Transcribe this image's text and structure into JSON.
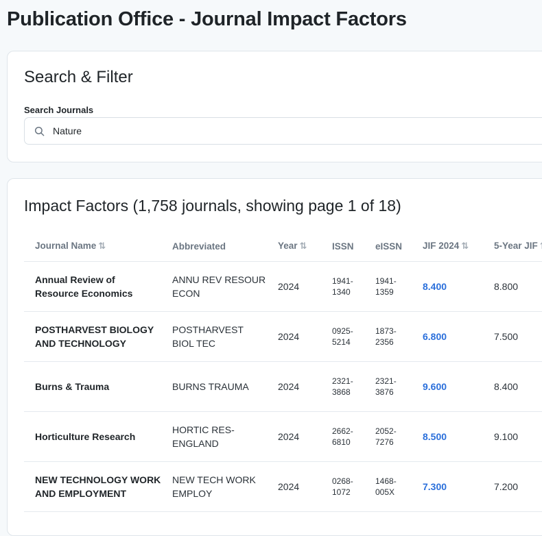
{
  "page": {
    "title": "Publication Office - Journal Impact Factors"
  },
  "search": {
    "heading": "Search & Filter",
    "label": "Search Journals",
    "value": "Nature",
    "icon": "search-icon"
  },
  "table": {
    "heading": "Impact Factors (1,758 journals, showing page 1 of 18)",
    "accent_color": "#2a6fdb",
    "columns": [
      {
        "label": "Journal Name",
        "sortable": true
      },
      {
        "label": "Abbreviated",
        "sortable": false
      },
      {
        "label": "Year",
        "sortable": true
      },
      {
        "label": "ISSN",
        "sortable": false
      },
      {
        "label": "eISSN",
        "sortable": false
      },
      {
        "label": "JIF 2024",
        "sortable": true
      },
      {
        "label": "5-Year JIF",
        "sortable": true
      }
    ],
    "sort_glyph": "⇅",
    "rows": [
      {
        "name": "Annual Review of Resource Economics",
        "abbr": "ANNU REV RESOUR ECON",
        "year": "2024",
        "issn": "1941-1340",
        "eissn": "1941-1359",
        "jif": "8.400",
        "jif5": "8.800"
      },
      {
        "name": "POSTHARVEST BIOLOGY AND TECHNOLOGY",
        "abbr": "POSTHARVEST BIOL TEC",
        "year": "2024",
        "issn": "0925-5214",
        "eissn": "1873-2356",
        "jif": "6.800",
        "jif5": "7.500"
      },
      {
        "name": "Burns & Trauma",
        "abbr": "BURNS TRAUMA",
        "year": "2024",
        "issn": "2321-3868",
        "eissn": "2321-3876",
        "jif": "9.600",
        "jif5": "8.400"
      },
      {
        "name": "Horticulture Research",
        "abbr": "HORTIC RES-ENGLAND",
        "year": "2024",
        "issn": "2662-6810",
        "eissn": "2052-7276",
        "jif": "8.500",
        "jif5": "9.100"
      },
      {
        "name": "NEW TECHNOLOGY WORK AND EMPLOYMENT",
        "abbr": "NEW TECH WORK EMPLOY",
        "year": "2024",
        "issn": "0268-1072",
        "eissn": "1468-005X",
        "jif": "7.300",
        "jif5": "7.200"
      }
    ]
  }
}
